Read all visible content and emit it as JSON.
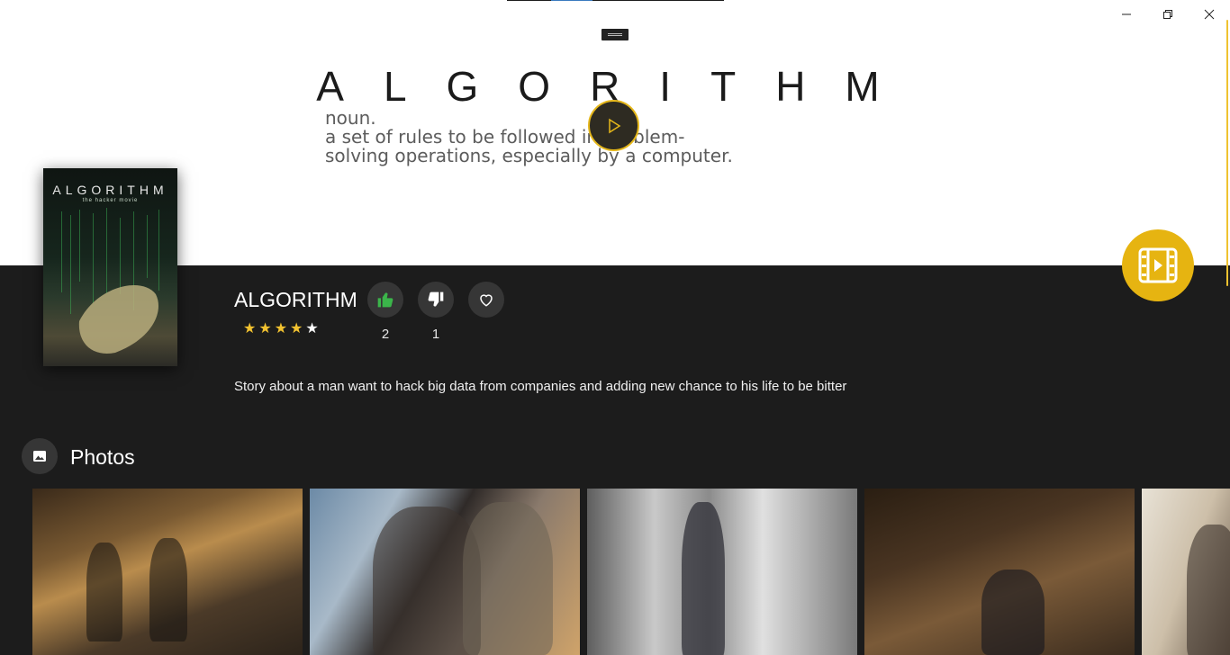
{
  "hero": {
    "big_word": "ALGORITHM",
    "definition_lines": "noun.\na set of rules to be followed in problem-\nsolving operations, especially by a computer."
  },
  "window_controls": {
    "minimize_icon": "minimize-icon",
    "maximize_icon": "restore-icon",
    "close_icon": "close-icon"
  },
  "poster": {
    "title": "ALGORITHM",
    "subtitle": "the hacker movie"
  },
  "movie": {
    "title": "ALGORITHM",
    "rating": 4,
    "rating_max": 5,
    "likes": "2",
    "dislikes": "1",
    "description": "Story about a man want to hack big data from companies and adding new chance to his life to be bitter"
  },
  "photos": {
    "heading": "Photos",
    "items": [
      "photo-1",
      "photo-2",
      "photo-3",
      "photo-4",
      "photo-5"
    ]
  },
  "colors": {
    "accent": "#e6b411",
    "like_green": "#3bb54a",
    "background": "#1c1c1c"
  }
}
